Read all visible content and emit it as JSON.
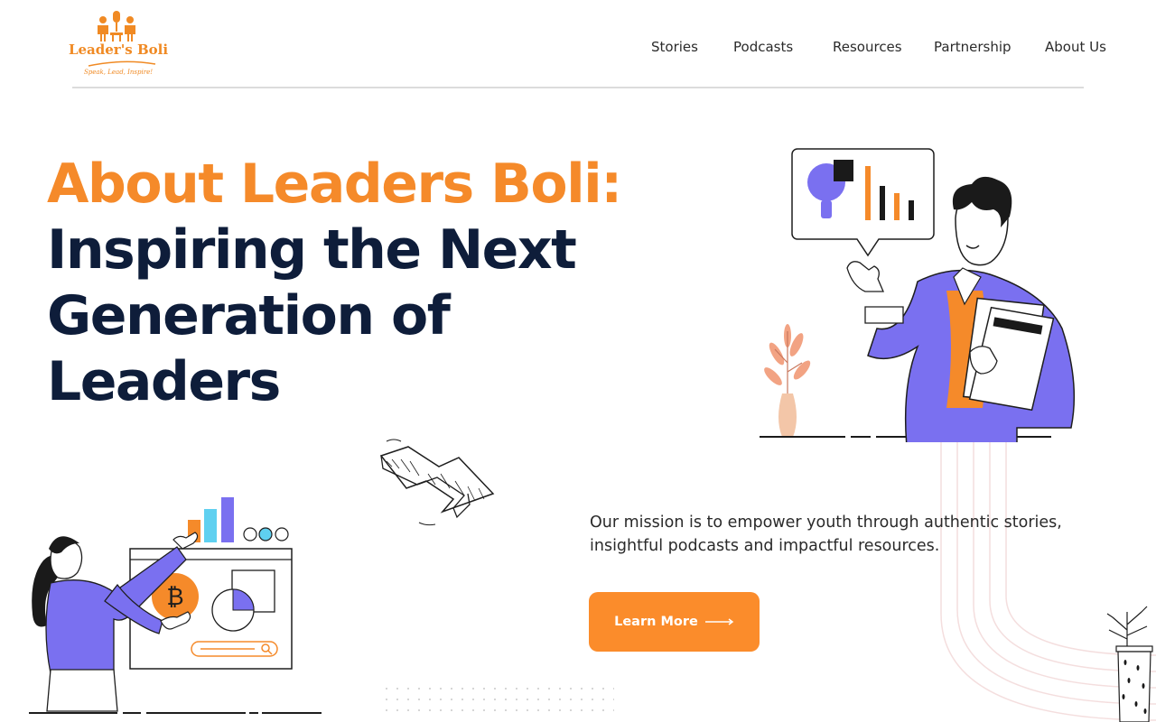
{
  "brand": {
    "name": "Leader's Boli",
    "tagline": "Speak, Lead, Inspire!",
    "color": "#f08a24"
  },
  "nav": {
    "items": [
      "Stories",
      "Podcasts",
      "Resources",
      "Partnership",
      "About Us"
    ]
  },
  "hero": {
    "title_line1": "About Leaders Boli:",
    "title_line2": "Inspiring the Next",
    "title_line3": "Generation of",
    "title_line4": "Leaders",
    "mission": "Our mission is to empower youth through authentic stories, insightful podcasts and impactful resources.",
    "cta_label": "Learn More"
  },
  "colors": {
    "accent": "#fb8c2b",
    "navy": "#0e1d3a",
    "purple": "#7a70f0",
    "cyan": "#5fd0f0"
  },
  "icons": {
    "logo": "podcast-duo-logo-icon",
    "cta": "long-arrow-right-icon",
    "currency": "currency-icon",
    "search": "search-icon"
  }
}
